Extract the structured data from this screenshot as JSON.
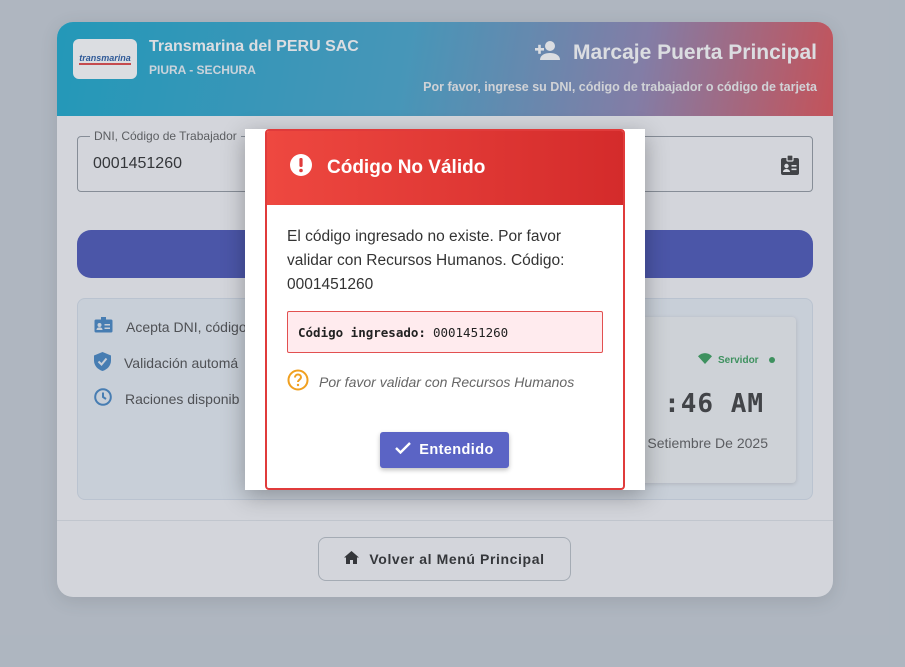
{
  "header": {
    "logo_text": "transmarina",
    "company": "Transmarina del PERU SAC",
    "location": "PIURA - SECHURA",
    "title": "Marcaje Puerta Principal",
    "subtitle": "Por favor, ingrese su DNI, código de trabajador o código de tarjeta",
    "title_icon": "person-add-icon"
  },
  "form": {
    "field_label": "DNI, Código de Trabajador",
    "field_value": "0001451260",
    "field_icon": "id-badge-icon"
  },
  "info": {
    "items": [
      {
        "icon": "id-card-icon",
        "label": "Acepta DNI, código"
      },
      {
        "icon": "shield-check-icon",
        "label": "Validación automá"
      },
      {
        "icon": "clock-icon",
        "label": "Raciones disponib"
      }
    ]
  },
  "clock": {
    "server_label": "Servidor",
    "time": ":46 AM",
    "date": "Setiembre De 2025"
  },
  "footer": {
    "back_label": "Volver al Menú Principal",
    "back_icon": "home-icon"
  },
  "dialog": {
    "title": "Código No Válido",
    "title_icon": "exclamation-icon",
    "message": "El código ingresado no existe. Por favor validar con Recursos Humanos. Código: 0001451260",
    "code_label": "Código ingresado:",
    "code_value": "0001451260",
    "hint": "Por favor validar con Recursos Humanos",
    "hint_icon": "question-circle-icon",
    "ok_label": "Entendido",
    "ok_icon": "check-icon"
  },
  "colors": {
    "primary": "#3f4bb3",
    "error": "#e03b3b",
    "success": "#2e9a52",
    "dialog_button": "#5b64c5"
  }
}
